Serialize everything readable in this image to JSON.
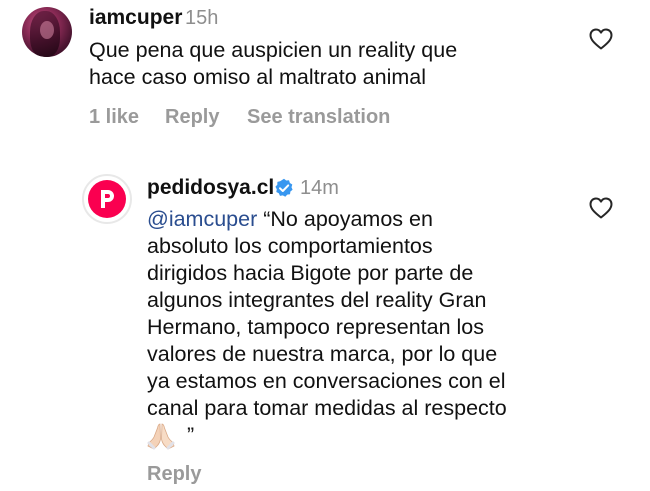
{
  "comments": [
    {
      "username": "iamcuper",
      "time": "15h",
      "text_lines": [
        "Que pena que auspicien un reality que",
        "hace caso omiso al maltrato animal"
      ],
      "likes_label": "1 like",
      "reply_label": "Reply",
      "see_translation_label": "See translation",
      "avatar_icon": "profile-photo",
      "like_icon": "heart-outline-icon"
    },
    {
      "username": "pedidosya.cl",
      "verified": true,
      "verified_icon": "verified-badge-icon",
      "verified_color": "#3897f0",
      "time": "14m",
      "mention": "@iamcuper",
      "first_line_rest": " “No apoyamos en",
      "text_lines": [
        "absoluto los comportamientos",
        "dirigidos hacia Bigote por parte de",
        "algunos integrantes del reality Gran",
        "Hermano, tampoco representan los",
        "valores de nuestra marca, por lo que",
        "ya estamos en conversaciones con el",
        "canal para tomar medidas al respecto"
      ],
      "emoji": "🙏🏻",
      "closing_quote": " ”",
      "reply_label": "Reply",
      "avatar_icon": "pedidosya-logo",
      "brand_color": "#fa0050",
      "like_icon": "heart-outline-icon"
    }
  ]
}
